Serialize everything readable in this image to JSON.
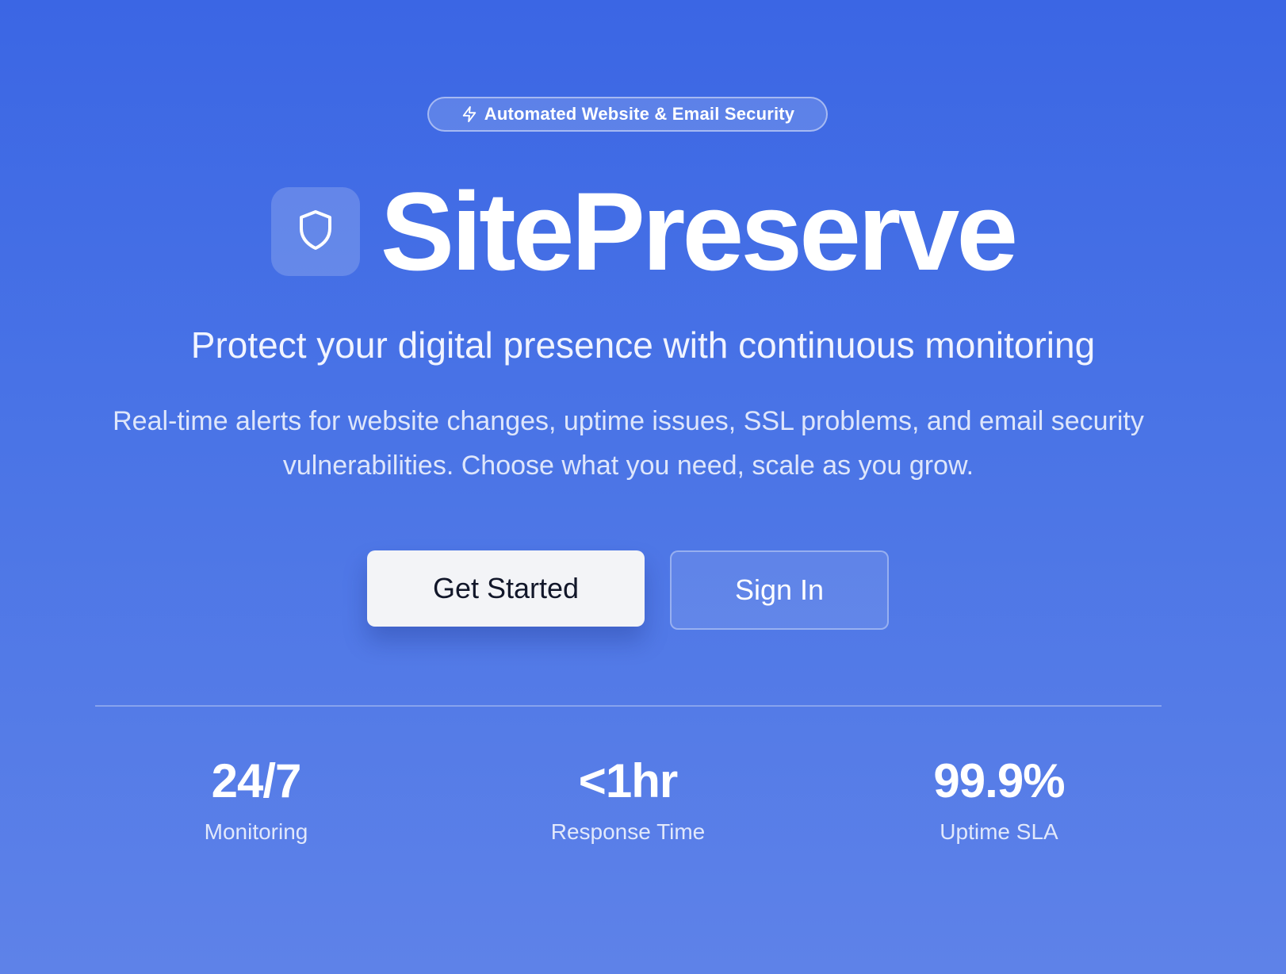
{
  "badge": {
    "icon": "lightning-icon",
    "label": "Automated Website & Email Security"
  },
  "brand": {
    "logo_icon": "shield-icon",
    "name": "SitePreserve"
  },
  "hero": {
    "subtitle": "Protect your digital presence with continuous monitoring",
    "description": "Real-time alerts for website changes, uptime issues, SSL problems, and email security vulnerabilities. Choose what you need, scale as you grow."
  },
  "actions": {
    "primary_label": "Get Started",
    "secondary_label": "Sign In"
  },
  "stats": [
    {
      "value": "24/7",
      "label": "Monitoring"
    },
    {
      "value": "<1hr",
      "label": "Response Time"
    },
    {
      "value": "99.9%",
      "label": "Uptime SLA"
    }
  ],
  "colors": {
    "background_top": "#3b66e4",
    "background_bottom": "#5e82e8",
    "primary_button_bg": "#f3f4f7",
    "primary_button_text": "#12172a",
    "text": "#ffffff"
  }
}
